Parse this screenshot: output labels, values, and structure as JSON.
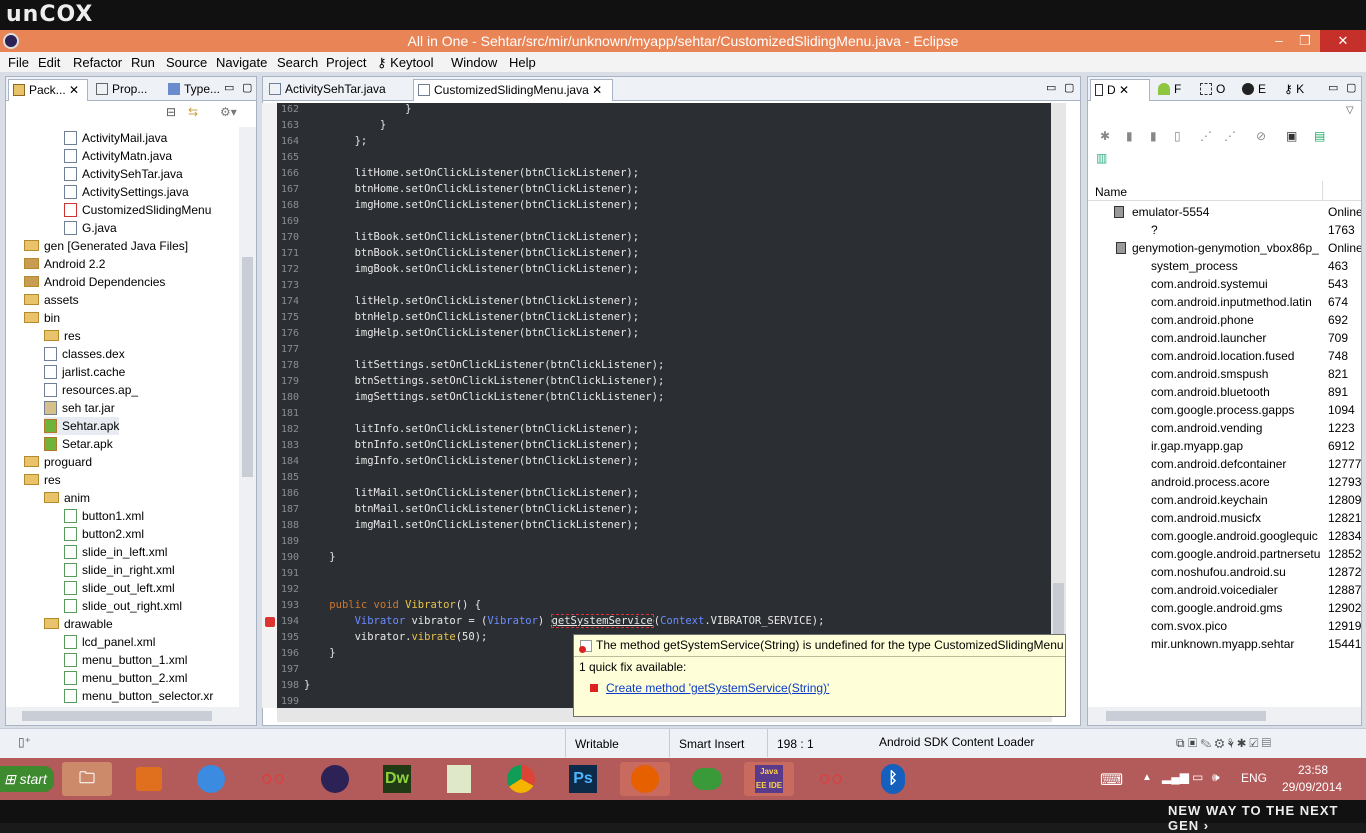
{
  "brand": "unCOX",
  "window": {
    "title": "All in One - Sehtar/src/mir/unknown/myapp/sehtar/CustomizedSlidingMenu.java - Eclipse",
    "min": "–",
    "max": "❐",
    "close": "✕"
  },
  "menu": [
    "File",
    "Edit",
    "Refactor",
    "Run",
    "Source",
    "Navigate",
    "Search",
    "Project",
    "Keytool",
    "Window",
    "Help"
  ],
  "left_panel": {
    "tabs": [
      "Pack...",
      "Prop...",
      "Type..."
    ],
    "tree": [
      {
        "label": "ActivityMail.java",
        "kind": "java",
        "indent": 3
      },
      {
        "label": "ActivityMatn.java",
        "kind": "java",
        "indent": 3
      },
      {
        "label": "ActivitySehTar.java",
        "kind": "java",
        "indent": 3
      },
      {
        "label": "ActivitySettings.java",
        "kind": "java",
        "indent": 3
      },
      {
        "label": "CustomizedSlidingMenu",
        "kind": "java-error",
        "indent": 3
      },
      {
        "label": "G.java",
        "kind": "java",
        "indent": 3
      },
      {
        "label": "gen [Generated Java Files]",
        "kind": "folder",
        "indent": 1
      },
      {
        "label": "Android 2.2",
        "kind": "lib",
        "indent": 1
      },
      {
        "label": "Android Dependencies",
        "kind": "lib",
        "indent": 1
      },
      {
        "label": "assets",
        "kind": "folder",
        "indent": 1
      },
      {
        "label": "bin",
        "kind": "folder",
        "indent": 1
      },
      {
        "label": "res",
        "kind": "folder",
        "indent": 2
      },
      {
        "label": "classes.dex",
        "kind": "file",
        "indent": 2
      },
      {
        "label": "jarlist.cache",
        "kind": "file",
        "indent": 2
      },
      {
        "label": "resources.ap_",
        "kind": "file",
        "indent": 2
      },
      {
        "label": "seh tar.jar",
        "kind": "jar",
        "indent": 2
      },
      {
        "label": "Sehtar.apk",
        "kind": "apk",
        "indent": 2
      },
      {
        "label": "Setar.apk",
        "kind": "apk",
        "indent": 2
      },
      {
        "label": "proguard",
        "kind": "folder",
        "indent": 1
      },
      {
        "label": "res",
        "kind": "folder",
        "indent": 1
      },
      {
        "label": "anim",
        "kind": "folder",
        "indent": 2
      },
      {
        "label": "button1.xml",
        "kind": "xml",
        "indent": 3
      },
      {
        "label": "button2.xml",
        "kind": "xml",
        "indent": 3
      },
      {
        "label": "slide_in_left.xml",
        "kind": "xml",
        "indent": 3
      },
      {
        "label": "slide_in_right.xml",
        "kind": "xml",
        "indent": 3
      },
      {
        "label": "slide_out_left.xml",
        "kind": "xml",
        "indent": 3
      },
      {
        "label": "slide_out_right.xml",
        "kind": "xml",
        "indent": 3
      },
      {
        "label": "drawable",
        "kind": "folder",
        "indent": 2
      },
      {
        "label": "lcd_panel.xml",
        "kind": "xml",
        "indent": 3
      },
      {
        "label": "menu_button_1.xml",
        "kind": "xml",
        "indent": 3
      },
      {
        "label": "menu_button_2.xml",
        "kind": "xml",
        "indent": 3
      },
      {
        "label": "menu_button_selector.xr",
        "kind": "xml",
        "indent": 3
      }
    ]
  },
  "editor": {
    "tabs": [
      "ActivitySehTar.java",
      "CustomizedSlidingMenu.java"
    ],
    "close": "✕",
    "lines": [
      {
        "n": "162",
        "t": "            }"
      },
      {
        "n": "163",
        "t": "        }"
      },
      {
        "n": "164",
        "t": "    };"
      },
      {
        "n": "165",
        "t": ""
      },
      {
        "n": "166",
        "t": "    litHome.setOnClickListener(btnClickListener);"
      },
      {
        "n": "167",
        "t": "    btnHome.setOnClickListener(btnClickListener);"
      },
      {
        "n": "168",
        "t": "    imgHome.setOnClickListener(btnClickListener);"
      },
      {
        "n": "169",
        "t": ""
      },
      {
        "n": "170",
        "t": "    litBook.setOnClickListener(btnClickListener);"
      },
      {
        "n": "171",
        "t": "    btnBook.setOnClickListener(btnClickListener);"
      },
      {
        "n": "172",
        "t": "    imgBook.setOnClickListener(btnClickListener);"
      },
      {
        "n": "173",
        "t": ""
      },
      {
        "n": "174",
        "t": "    litHelp.setOnClickListener(btnClickListener);"
      },
      {
        "n": "175",
        "t": "    btnHelp.setOnClickListener(btnClickListener);"
      },
      {
        "n": "176",
        "t": "    imgHelp.setOnClickListener(btnClickListener);"
      },
      {
        "n": "177",
        "t": ""
      },
      {
        "n": "178",
        "t": "    litSettings.setOnClickListener(btnClickListener);"
      },
      {
        "n": "179",
        "t": "    btnSettings.setOnClickListener(btnClickListener);"
      },
      {
        "n": "180",
        "t": "    imgSettings.setOnClickListener(btnClickListener);"
      },
      {
        "n": "181",
        "t": ""
      },
      {
        "n": "182",
        "t": "    litInfo.setOnClickListener(btnClickListener);"
      },
      {
        "n": "183",
        "t": "    btnInfo.setOnClickListener(btnClickListener);"
      },
      {
        "n": "184",
        "t": "    imgInfo.setOnClickListener(btnClickListener);"
      },
      {
        "n": "185",
        "t": ""
      },
      {
        "n": "186",
        "t": "    litMail.setOnClickListener(btnClickListener);"
      },
      {
        "n": "187",
        "t": "    btnMail.setOnClickListener(btnClickListener);"
      },
      {
        "n": "188",
        "t": "    imgMail.setOnClickListener(btnClickListener);"
      },
      {
        "n": "189",
        "t": ""
      },
      {
        "n": "190",
        "t": "}"
      },
      {
        "n": "191",
        "t": ""
      },
      {
        "n": "192",
        "t": ""
      }
    ],
    "method_line": {
      "n": "193",
      "kw": "public void ",
      "name": "Vibrator",
      "rest": "() {"
    },
    "err_line": {
      "n": "194",
      "a": "Vibrator",
      "b": " vibrator = (",
      "c": "Vibrator",
      "d": ") ",
      "e": "getSystemService",
      "f": "(",
      "g": "Context",
      "h": ".VIBRATOR_SERVICE);"
    },
    "vib_line": {
      "n": "195",
      "t": "vibrator.",
      "call": "vibrate",
      "arg": "(50);"
    },
    "tail": [
      {
        "n": "196",
        "t": "}"
      },
      {
        "n": "197",
        "t": ""
      },
      {
        "n": "198",
        "t": "}"
      },
      {
        "n": "199",
        "t": ""
      }
    ]
  },
  "hover": {
    "message": "The method getSystemService(String) is undefined for the type CustomizedSlidingMenu",
    "quickfix_count": "1 quick fix available:",
    "fix": "Create method 'getSystemService(String)'"
  },
  "right_panel": {
    "tabs": [
      "D",
      "F",
      "O",
      "E",
      "K"
    ],
    "col_name": "Name",
    "rows": [
      {
        "name": "emulator-5554",
        "val": "Online",
        "indent": 1,
        "icon": "device"
      },
      {
        "name": "?",
        "val": "1763",
        "indent": 2
      },
      {
        "name": "genymotion-genymotion_vbox86p_",
        "val": "Online",
        "indent": 1,
        "icon": "device"
      },
      {
        "name": "system_process",
        "val": "463",
        "indent": 2
      },
      {
        "name": "com.android.systemui",
        "val": "543",
        "indent": 2
      },
      {
        "name": "com.android.inputmethod.latin",
        "val": "674",
        "indent": 2
      },
      {
        "name": "com.android.phone",
        "val": "692",
        "indent": 2
      },
      {
        "name": "com.android.launcher",
        "val": "709",
        "indent": 2
      },
      {
        "name": "com.android.location.fused",
        "val": "748",
        "indent": 2
      },
      {
        "name": "com.android.smspush",
        "val": "821",
        "indent": 2
      },
      {
        "name": "com.android.bluetooth",
        "val": "891",
        "indent": 2
      },
      {
        "name": "com.google.process.gapps",
        "val": "1094",
        "indent": 2
      },
      {
        "name": "com.android.vending",
        "val": "1223",
        "indent": 2
      },
      {
        "name": "ir.gap.myapp.gap",
        "val": "6912",
        "indent": 2
      },
      {
        "name": "com.android.defcontainer",
        "val": "12777",
        "indent": 2
      },
      {
        "name": "android.process.acore",
        "val": "12793",
        "indent": 2
      },
      {
        "name": "com.android.keychain",
        "val": "12809",
        "indent": 2
      },
      {
        "name": "com.android.musicfx",
        "val": "12821",
        "indent": 2
      },
      {
        "name": "com.google.android.googlequic",
        "val": "12834",
        "indent": 2
      },
      {
        "name": "com.google.android.partnersetu",
        "val": "12852",
        "indent": 2
      },
      {
        "name": "com.noshufou.android.su",
        "val": "12872",
        "indent": 2
      },
      {
        "name": "com.android.voicedialer",
        "val": "12887",
        "indent": 2
      },
      {
        "name": "com.google.android.gms",
        "val": "12902",
        "indent": 2
      },
      {
        "name": "com.svox.pico",
        "val": "12919",
        "indent": 2
      },
      {
        "name": "mir.unknown.myapp.sehtar",
        "val": "15441",
        "indent": 2
      }
    ]
  },
  "status": {
    "writable": "Writable",
    "insert": "Smart Insert",
    "pos": "198 : 1",
    "loader": "Android SDK Content Loader"
  },
  "taskbar": {
    "start": "start",
    "lang": "ENG",
    "time": "23:58",
    "date": "29/09/2014",
    "apps": [
      "Dw",
      "Ps",
      "Java EE IDE"
    ]
  },
  "footer": "NEW WAY TO THE NEXT GEN ›",
  "colors": {
    "accent": "#e98456",
    "editor_bg": "#2b2f33",
    "taskbar": "#b35a5a"
  }
}
